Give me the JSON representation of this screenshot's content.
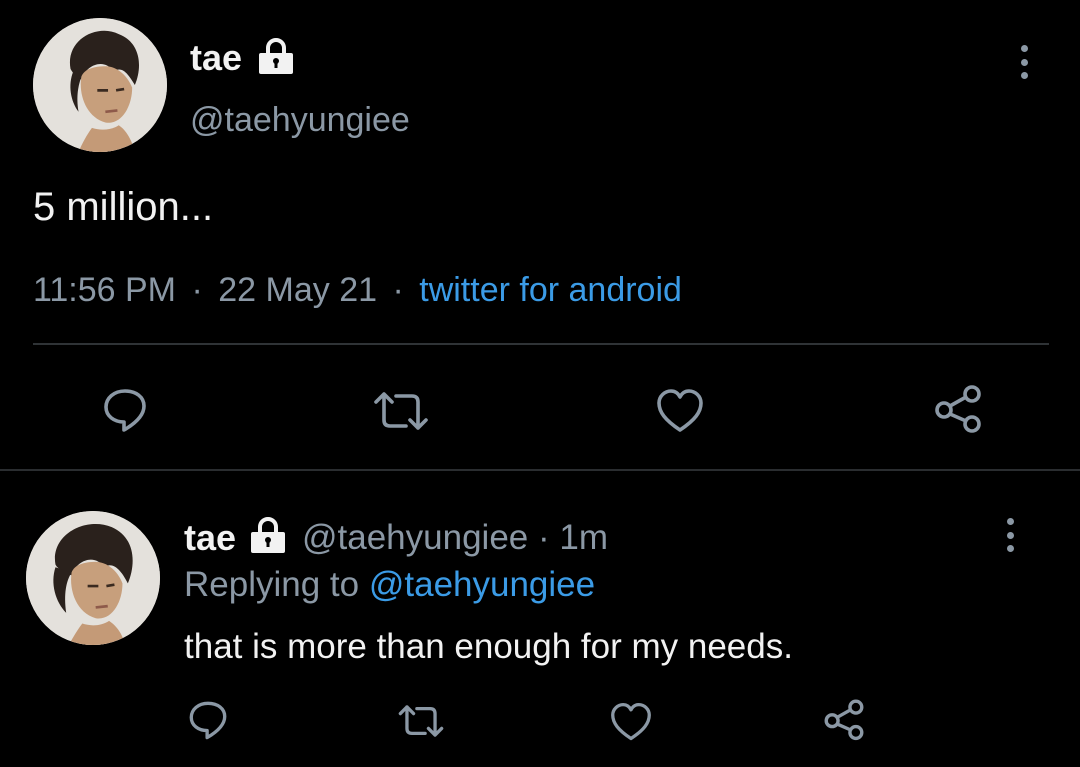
{
  "colors": {
    "background": "#000000",
    "text": "#e7e9ea",
    "muted": "#8b98a5",
    "link": "#3b9be6",
    "divider": "#2f3336"
  },
  "main_tweet": {
    "display_name": "tae",
    "handle": "@taehyungiee",
    "text": "5 million...",
    "time": "11:56 PM",
    "separator": "·",
    "date": "22 May 21",
    "source": "twitter for android",
    "icons": [
      "lock-icon",
      "more-options-icon",
      "reply-icon",
      "retweet-icon",
      "like-icon",
      "share-icon"
    ]
  },
  "reply_tweet": {
    "display_name": "tae",
    "handle_and_time": "@taehyungiee · 1m",
    "replying_prefix": "Replying to",
    "replying_to": "@taehyungiee",
    "text": "that is more than enough for my needs.",
    "icons": [
      "lock-icon",
      "more-options-icon",
      "reply-icon",
      "retweet-icon",
      "like-icon",
      "share-icon"
    ]
  }
}
